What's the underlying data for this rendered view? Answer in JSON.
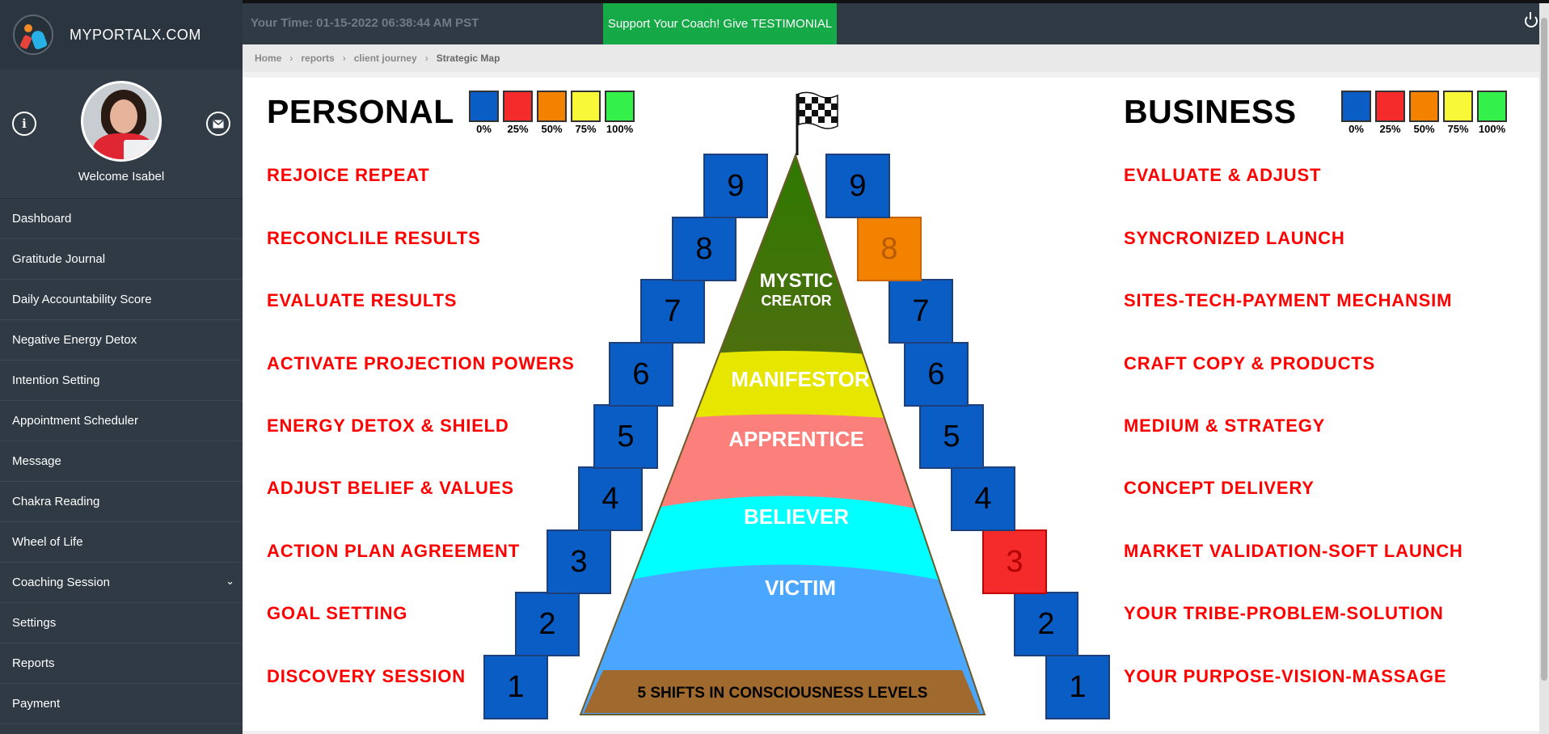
{
  "app": {
    "brand": "MYPORTALX.COM"
  },
  "profile": {
    "welcome": "Welcome Isabel"
  },
  "nav": {
    "items": [
      {
        "label": "Dashboard"
      },
      {
        "label": "Gratitude Journal"
      },
      {
        "label": "Daily Accountability Score"
      },
      {
        "label": "Negative Energy Detox"
      },
      {
        "label": "Intention Setting"
      },
      {
        "label": "Appointment Scheduler"
      },
      {
        "label": "Message"
      },
      {
        "label": "Chakra Reading"
      },
      {
        "label": "Wheel of Life"
      },
      {
        "label": "Coaching Session"
      },
      {
        "label": "Settings"
      },
      {
        "label": "Reports"
      },
      {
        "label": "Payment"
      }
    ]
  },
  "topbar": {
    "time": "Your Time: 01-15-2022 06:38:44 AM PST",
    "testimonial": "Support Your Coach! Give TESTIMONIAL"
  },
  "breadcrumb": {
    "home": "Home",
    "reports": "reports",
    "journey": "client journey",
    "current": "Strategic Map"
  },
  "map": {
    "personal_title": "PERSONAL",
    "business_title": "BUSINESS",
    "legend": [
      {
        "label": "0%",
        "color": "#0a5dc4"
      },
      {
        "label": "25%",
        "color": "#f52a2a"
      },
      {
        "label": "50%",
        "color": "#f38200"
      },
      {
        "label": "75%",
        "color": "#f8f838"
      },
      {
        "label": "100%",
        "color": "#33f04a"
      }
    ],
    "personal_steps": [
      "DISCOVERY SESSION",
      "GOAL SETTING",
      "ACTION PLAN AGREEMENT",
      "ADJUST BELIEF & VALUES",
      "ENERGY DETOX & SHIELD",
      "ACTIVATE PROJECTION POWERS",
      "EVALUATE RESULTS",
      "RECONCLILE RESULTS",
      "REJOICE REPEAT"
    ],
    "business_steps": [
      "YOUR PURPOSE-VISION-MASSAGE",
      "YOUR TRIBE-PROBLEM-SOLUTION",
      "MARKET VALIDATION-SOFT LAUNCH",
      "CONCEPT DELIVERY",
      "MEDIUM & STRATEGY",
      "CRAFT COPY & PRODUCTS",
      "SITES-TECH-PAYMENT MECHANSIM",
      "SYNCRONIZED LAUNCH",
      "EVALUATE & ADJUST"
    ],
    "step_numbers": [
      "1",
      "2",
      "3",
      "4",
      "5",
      "6",
      "7",
      "8",
      "9"
    ],
    "business_status": [
      "blue",
      "blue",
      "red",
      "blue",
      "blue",
      "blue",
      "blue",
      "orange",
      "blue"
    ],
    "levels": {
      "mystic": "MYSTIC",
      "creator": "CREATOR",
      "manifestor": "MANIFESTOR",
      "apprentice": "APPRENTICE",
      "believer": "BELIEVER",
      "victim": "VICTIM",
      "base": "5 SHIFTS IN CONSCIOUSNESS LEVELS"
    }
  }
}
